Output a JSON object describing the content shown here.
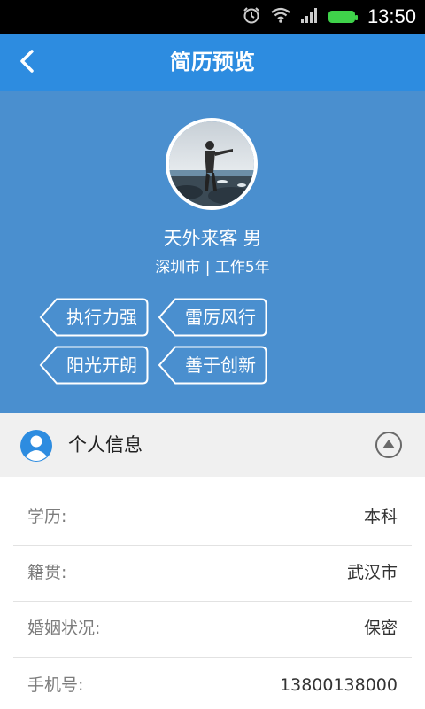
{
  "status_bar": {
    "time": "13:50",
    "icons": [
      "alarm-icon",
      "wifi-icon",
      "signal-icon",
      "battery-icon"
    ]
  },
  "header": {
    "title": "简历预览",
    "back_icon": "chevron-left-icon"
  },
  "profile": {
    "name": "天外来客",
    "gender": "男",
    "city_experience": "深圳市 | 工作5年",
    "tags": [
      "执行力强",
      "雷厉风行",
      "阳光开朗",
      "善于创新"
    ]
  },
  "section": {
    "title": "个人信息",
    "icon": "person-icon",
    "toggle_icon": "collapse-up-icon"
  },
  "info": [
    {
      "label": "学历:",
      "value": "本科"
    },
    {
      "label": "籍贯:",
      "value": "武汉市"
    },
    {
      "label": "婚姻状况:",
      "value": "保密"
    },
    {
      "label": "手机号:",
      "value": "13800138000"
    }
  ],
  "colors": {
    "title_bar": "#2d8ce0",
    "profile_bg": "#4a8fcf",
    "section_bg": "#f0f0f0",
    "battery": "#3fd24a"
  }
}
